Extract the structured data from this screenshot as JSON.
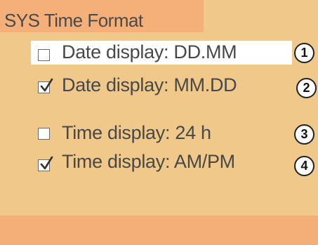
{
  "header": {
    "title": "SYS Time Format"
  },
  "colors": {
    "panel_background": "#f0c88a",
    "title_bar": "#f5b07a",
    "bottom_bar": "#f4ae78",
    "selection_highlight": "#ffffff"
  },
  "options": [
    {
      "label": "Date display: DD.MM",
      "checked": false,
      "highlighted": true,
      "badge": "1"
    },
    {
      "label": "Date display: MM.DD",
      "checked": true,
      "highlighted": false,
      "badge": "2"
    },
    {
      "label": "Time display: 24 h",
      "checked": false,
      "highlighted": false,
      "badge": "3"
    },
    {
      "label": "Time display: AM/PM",
      "checked": true,
      "highlighted": false,
      "badge": "4"
    }
  ]
}
